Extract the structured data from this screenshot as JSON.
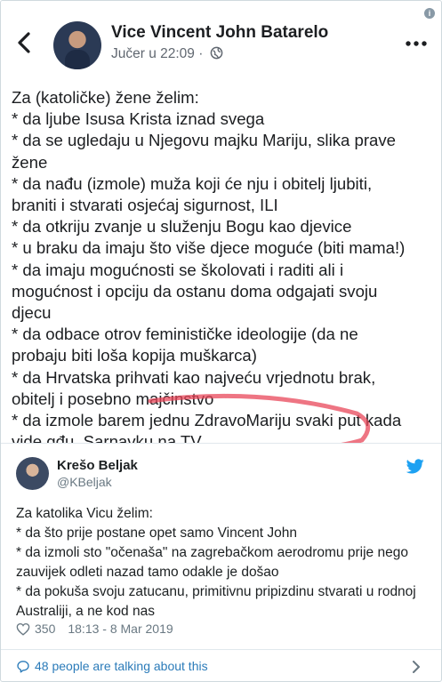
{
  "facebook_post": {
    "author": "Vice Vincent John Batarelo",
    "meta": "Jučer u 22:09 ·",
    "icons": [
      "back-arrow-icon",
      "globe-icon",
      "more-icon",
      "info-icon"
    ],
    "lines": [
      "Za (katoličke) žene želim:",
      "* da ljube Isusa Krista iznad svega",
      "* da se ugledaju u Njegovu majku Mariju, slika prave",
      "žene",
      "* da nađu (izmole) muža koji će nju i obitelj ljubiti,",
      "braniti i stvarati osjećaj sigurnost, ILI",
      "* da otkriju zvanje u služenju Bogu kao djevice",
      "* u braku da imaju što više djece moguće (biti mama!)",
      "* da imaju mogućnosti se školovati i raditi ali i",
      "mogućnost i opciju da ostanu doma odgajati svoju",
      "djecu",
      "* da odbace otrov feminističke ideologije (da ne",
      "probaju biti loša kopija muškarca)",
      "* da Hrvatska prihvati kao najveću vrjednotu brak,",
      "obitelj i posebno majčinstvo",
      "* da izmole barem jednu ZdravoMariju svaki put kada",
      "vide gđu. Sarnavku na TV"
    ],
    "highlight_color": "#e8475a"
  },
  "tweet": {
    "name": "Krešo Beljak",
    "handle": "@KBeljak",
    "text_lines": [
      "Za katolika Vicu želim:",
      "* da što prije postane opet samo Vincent John",
      "* da izmoli sto \"očenaša\" na zagrebačkom aerodromu prije nego zauvijek odleti nazad tamo odakle je došao",
      "* da pokuša svoju zatucanu, primitivnu pripizdinu stvarati u rodnoj Australiji, a ne kod nas"
    ],
    "likes": "350",
    "timestamp": "18:13 - 8 Mar 2019",
    "talking": "48 people are talking about this",
    "brand_color": "#1da1f2",
    "link_color": "#2b7bb9"
  }
}
